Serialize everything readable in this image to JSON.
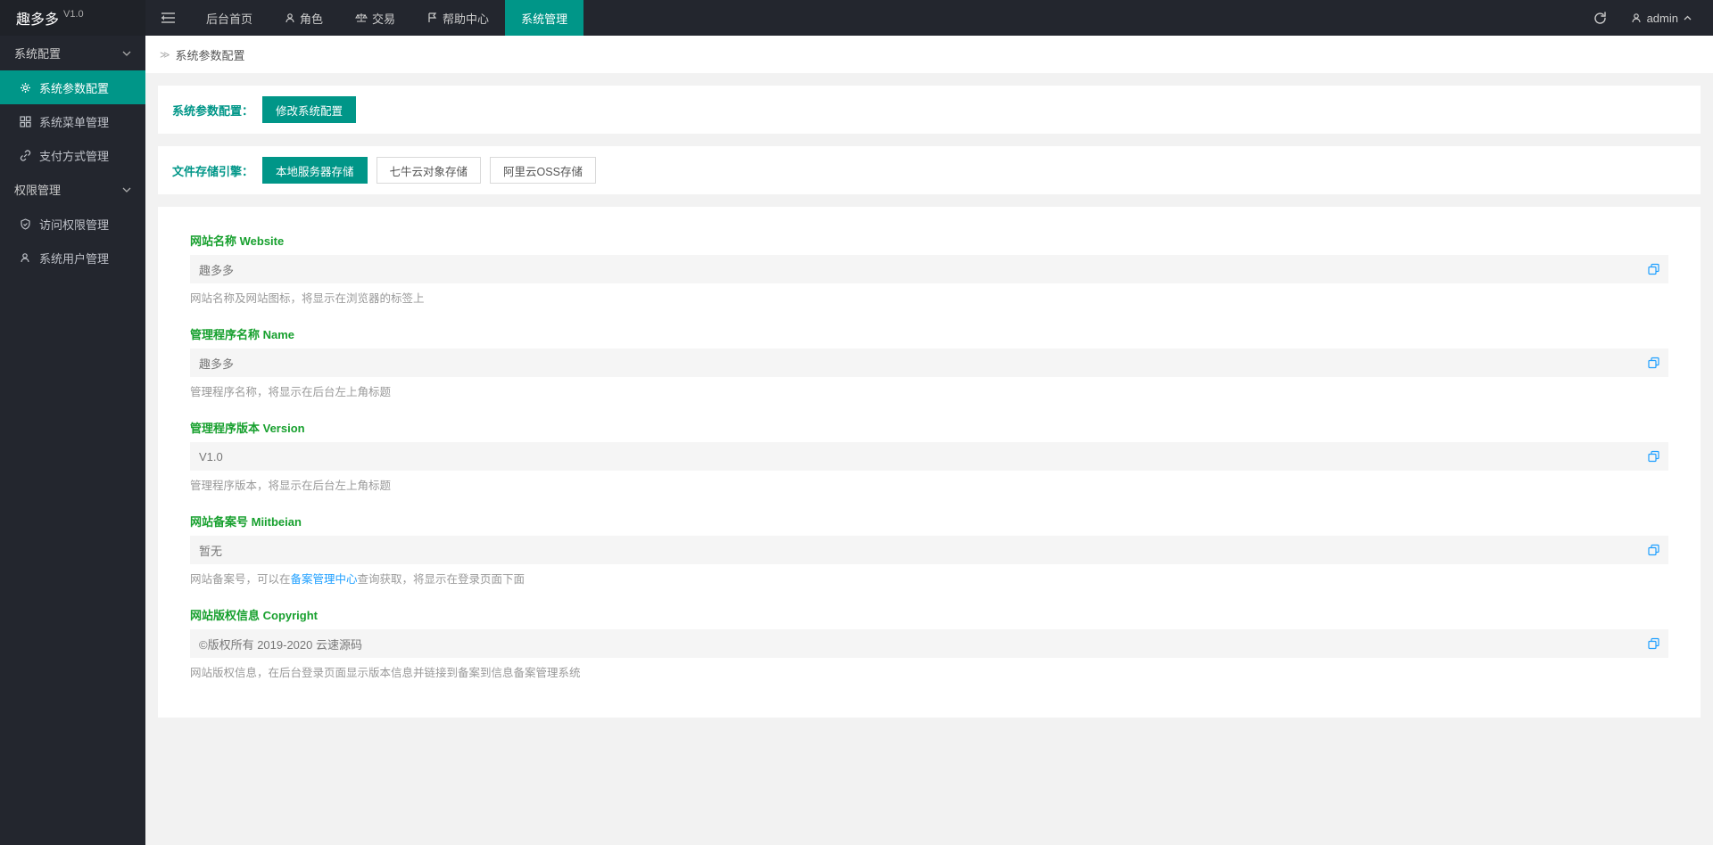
{
  "app": {
    "name": "趣多多",
    "version": "V1.0"
  },
  "topnav": {
    "items": [
      {
        "label": "后台首页",
        "icon": ""
      },
      {
        "label": "角色",
        "icon": "user"
      },
      {
        "label": "交易",
        "icon": "scale"
      },
      {
        "label": "帮助中心",
        "icon": "flag"
      },
      {
        "label": "系统管理",
        "icon": ""
      }
    ],
    "active": 4
  },
  "user": {
    "name": "admin"
  },
  "sidebar": {
    "groups": [
      {
        "label": "系统配置",
        "items": [
          {
            "label": "系统参数配置",
            "icon": "gear",
            "active": true
          },
          {
            "label": "系统菜单管理",
            "icon": "grid",
            "active": false
          },
          {
            "label": "支付方式管理",
            "icon": "link",
            "active": false
          }
        ]
      },
      {
        "label": "权限管理",
        "items": [
          {
            "label": "访问权限管理",
            "icon": "shield",
            "active": false
          },
          {
            "label": "系统用户管理",
            "icon": "user",
            "active": false
          }
        ]
      }
    ]
  },
  "breadcrumb": {
    "text": "系统参数配置"
  },
  "section1": {
    "label": "系统参数配置：",
    "buttonLabel": "修改系统配置"
  },
  "section2": {
    "label": "文件存储引擎：",
    "options": [
      "本地服务器存储",
      "七牛云对象存储",
      "阿里云OSS存储"
    ],
    "selected": 0
  },
  "form": {
    "fields": [
      {
        "label": "网站名称 Website",
        "value": "趣多多",
        "hint": "网站名称及网站图标，将显示在浏览器的标签上"
      },
      {
        "label": "管理程序名称 Name",
        "value": "趣多多",
        "hint": "管理程序名称，将显示在后台左上角标题"
      },
      {
        "label": "管理程序版本 Version",
        "value": "V1.0",
        "hint": "管理程序版本，将显示在后台左上角标题"
      },
      {
        "label": "网站备案号 Miitbeian",
        "value": "暂无",
        "hint_prefix": "网站备案号，可以在",
        "hint_link": "备案管理中心",
        "hint_suffix": "查询获取，将显示在登录页面下面"
      },
      {
        "label": "网站版权信息 Copyright",
        "value": "©版权所有 2019-2020 云速源码",
        "hint": "网站版权信息，在后台登录页面显示版本信息并链接到备案到信息备案管理系统"
      }
    ]
  }
}
